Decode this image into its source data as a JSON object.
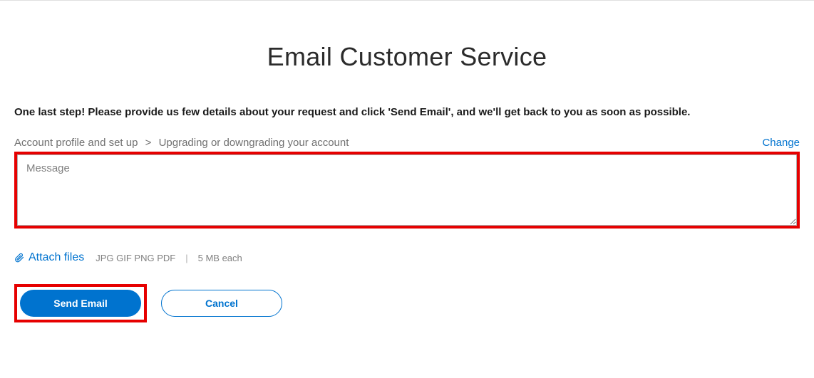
{
  "title": "Email Customer Service",
  "instruction": "One last step! Please provide us few details about your request and click 'Send Email', and we'll get back to you as soon as possible.",
  "breadcrumb": {
    "level1": "Account profile and set up",
    "separator": ">",
    "level2": "Upgrading or downgrading your account"
  },
  "change_label": "Change",
  "message": {
    "placeholder": "Message",
    "value": ""
  },
  "attach": {
    "label": "Attach files",
    "formats": "JPG GIF PNG PDF",
    "separator": "|",
    "size_hint": "5 MB each"
  },
  "buttons": {
    "send": "Send Email",
    "cancel": "Cancel"
  }
}
